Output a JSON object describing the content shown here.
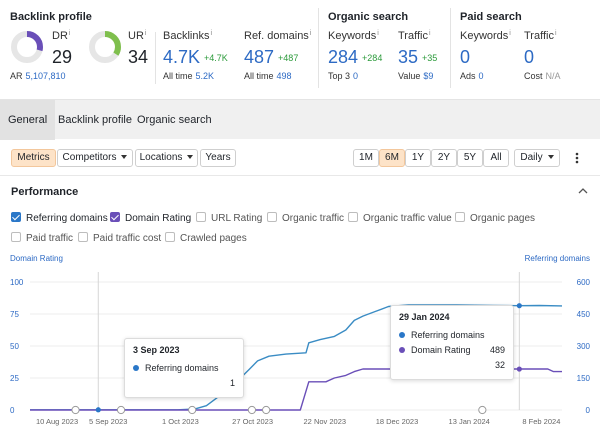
{
  "backlink_profile": {
    "title": "Backlink profile",
    "dr": {
      "label": "DR",
      "value": "29",
      "gauge": 0.29
    },
    "ur": {
      "label": "UR",
      "value": "34",
      "gauge": 0.34
    },
    "ar": {
      "label": "AR",
      "value": "5,107,810"
    },
    "backlinks": {
      "label": "Backlinks",
      "value": "4.7K",
      "delta": "+4.7K",
      "sub_label": "All time",
      "sub_value": "5.2K"
    },
    "ref_domains": {
      "label": "Ref. domains",
      "value": "487",
      "delta": "+487",
      "sub_label": "All time",
      "sub_value": "498"
    }
  },
  "organic_search": {
    "title": "Organic search",
    "keywords": {
      "label": "Keywords",
      "value": "284",
      "delta": "+284",
      "sub_label": "Top 3",
      "sub_value": "0"
    },
    "traffic": {
      "label": "Traffic",
      "value": "35",
      "delta": "+35",
      "sub_label": "Value",
      "sub_value": "$9"
    }
  },
  "paid_search": {
    "title": "Paid search",
    "keywords": {
      "label": "Keywords",
      "value": "0",
      "sub_label": "Ads",
      "sub_value": "0"
    },
    "traffic": {
      "label": "Traffic",
      "value": "0",
      "sub_label": "Cost",
      "sub_value": "N/A"
    }
  },
  "tabs": [
    "General",
    "Backlink profile",
    "Organic search"
  ],
  "toolbar": {
    "metrics": "Metrics",
    "competitors": "Competitors",
    "locations": "Locations",
    "years": "Years",
    "ranges": [
      "1M",
      "6M",
      "1Y",
      "2Y",
      "5Y",
      "All"
    ],
    "active_range": "6M",
    "interval": "Daily"
  },
  "performance": {
    "title": "Performance",
    "checkboxes": [
      {
        "label": "Referring domains",
        "checked": true
      },
      {
        "label": "Domain Rating",
        "checked": true
      },
      {
        "label": "URL Rating",
        "checked": false
      },
      {
        "label": "Organic traffic",
        "checked": false
      },
      {
        "label": "Organic traffic value",
        "checked": false
      },
      {
        "label": "Organic pages",
        "checked": false
      },
      {
        "label": "Paid traffic",
        "checked": false
      },
      {
        "label": "Paid traffic cost",
        "checked": false
      },
      {
        "label": "Crawled pages",
        "checked": false
      }
    ]
  },
  "colors": {
    "referring_domains": "#3a8cc4",
    "domain_rating": "#6a4fb8",
    "accent_orange": "#fde3c8"
  },
  "chart_data": {
    "type": "line",
    "left_axis_label": "Domain Rating",
    "right_axis_label": "Referring domains",
    "left_ticks": [
      "100",
      "75",
      "50",
      "25",
      "0"
    ],
    "right_ticks": [
      "600",
      "450",
      "300",
      "150",
      "0"
    ],
    "left_ylim": [
      0,
      100
    ],
    "right_ylim": [
      0,
      600
    ],
    "x_ticks": [
      "10 Aug 2023",
      "5 Sep 2023",
      "1 Oct 2023",
      "27 Oct 2023",
      "22 Nov 2023",
      "18 Dec 2023",
      "13 Jan 2024",
      "8 Feb 2024"
    ],
    "x_range": [
      "2023-08-10",
      "2024-02-13"
    ],
    "series": [
      {
        "name": "Referring domains",
        "axis": "right",
        "points": [
          [
            "2023-08-10",
            1
          ],
          [
            "2023-09-03",
            1
          ],
          [
            "2023-10-01",
            1
          ],
          [
            "2023-10-07",
            5
          ],
          [
            "2023-10-11",
            20
          ],
          [
            "2023-10-15",
            60
          ],
          [
            "2023-10-19",
            110
          ],
          [
            "2023-10-23",
            150
          ],
          [
            "2023-10-26",
            190
          ],
          [
            "2023-10-29",
            230
          ],
          [
            "2023-11-02",
            252
          ],
          [
            "2023-11-08",
            262
          ],
          [
            "2023-11-15",
            268
          ],
          [
            "2023-11-16",
            315
          ],
          [
            "2023-11-20",
            330
          ],
          [
            "2023-11-25",
            345
          ],
          [
            "2023-11-29",
            375
          ],
          [
            "2023-12-02",
            420
          ],
          [
            "2023-12-05",
            440
          ],
          [
            "2023-12-09",
            460
          ],
          [
            "2023-12-14",
            485
          ],
          [
            "2023-12-21",
            492
          ],
          [
            "2024-01-07",
            492
          ],
          [
            "2024-01-20",
            490
          ],
          [
            "2024-01-29",
            489
          ],
          [
            "2024-02-05",
            490
          ],
          [
            "2024-02-13",
            488
          ]
        ]
      },
      {
        "name": "Domain Rating",
        "axis": "left",
        "points": [
          [
            "2023-08-10",
            0
          ],
          [
            "2023-11-13",
            0
          ],
          [
            "2023-11-16",
            22
          ],
          [
            "2023-11-22",
            22
          ],
          [
            "2023-11-25",
            25
          ],
          [
            "2023-11-29",
            27
          ],
          [
            "2023-12-02",
            30
          ],
          [
            "2023-12-05",
            32
          ],
          [
            "2023-12-20",
            32
          ],
          [
            "2024-01-01",
            31
          ],
          [
            "2024-01-10",
            32
          ],
          [
            "2024-01-29",
            32
          ],
          [
            "2024-02-08",
            32
          ],
          [
            "2024-02-10",
            30
          ],
          [
            "2024-02-13",
            30
          ]
        ]
      }
    ],
    "markers": [
      "2023-08-26",
      "2023-09-11",
      "2023-10-06",
      "2023-10-27",
      "2023-11-01",
      "2024-01-16"
    ],
    "tooltip_left": {
      "date": "3 Sep 2023",
      "rows": [
        {
          "name": "Referring domains",
          "value": "1"
        }
      ]
    },
    "tooltip_right": {
      "date": "29 Jan 2024",
      "rows": [
        {
          "name": "Referring domains",
          "value": "489"
        },
        {
          "name": "Domain Rating",
          "value": "32"
        }
      ]
    }
  }
}
